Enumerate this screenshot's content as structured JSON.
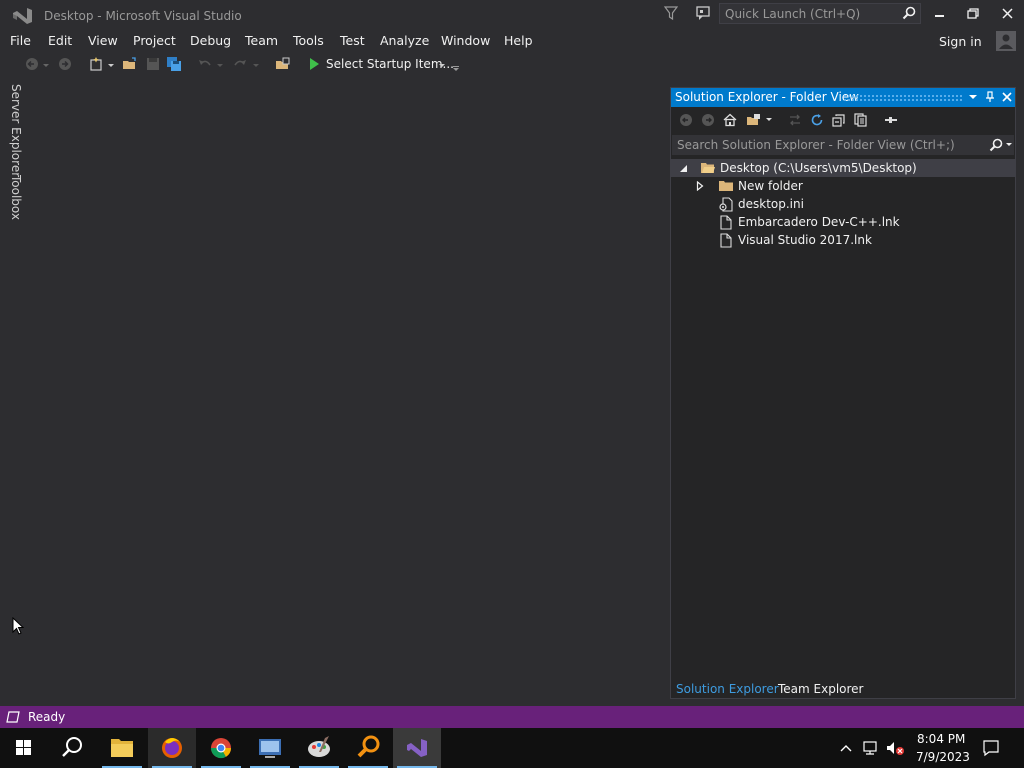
{
  "window": {
    "title": "Desktop - Microsoft Visual Studio"
  },
  "quick_launch": {
    "placeholder": "Quick Launch (Ctrl+Q)"
  },
  "menu": [
    "File",
    "Edit",
    "View",
    "Project",
    "Debug",
    "Team",
    "Tools",
    "Test",
    "Analyze",
    "Window",
    "Help"
  ],
  "account": {
    "sign_in": "Sign in"
  },
  "toolbar": {
    "startup": "Select Startup Item..."
  },
  "left_rail": {
    "server_explorer": "Server Explorer",
    "toolbox": "Toolbox"
  },
  "solution_explorer": {
    "title": "Solution Explorer - Folder View",
    "search_placeholder": "Search Solution Explorer - Folder View (Ctrl+;)",
    "tree": {
      "root": "Desktop (C:\\Users\\vm5\\Desktop)",
      "items": [
        "New folder",
        "desktop.ini",
        "Embarcadero Dev-C++.lnk",
        "Visual Studio 2017.lnk"
      ]
    },
    "tabs": [
      "Solution Explorer",
      "Team Explorer"
    ]
  },
  "status": {
    "text": "Ready"
  },
  "taskbar": {
    "time": "8:04 PM",
    "date": "7/9/2023"
  },
  "colors": {
    "accent": "#007acc",
    "status_bar": "#68217a",
    "background": "#2d2d30"
  }
}
